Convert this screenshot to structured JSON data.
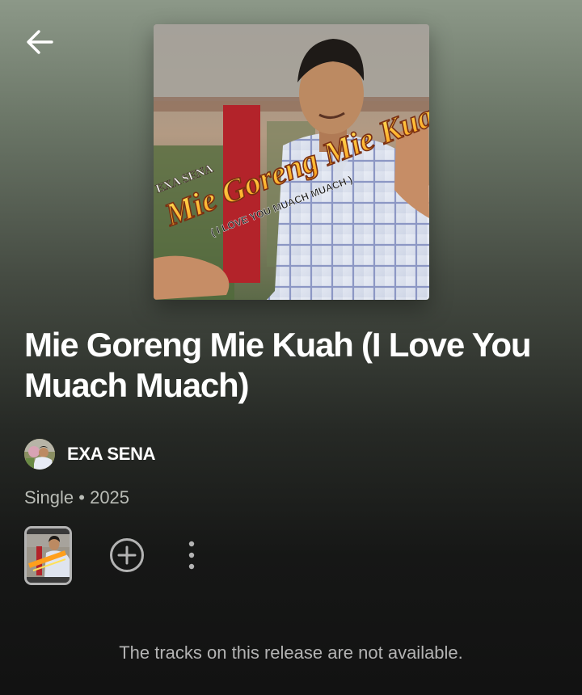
{
  "header": {
    "back_icon": "arrow-left-icon"
  },
  "album": {
    "cover_text": {
      "artist": "EXA SENA",
      "title": "Mie Goreng Mie Kuah",
      "subtitle": "( I LOVE YOU MUACH MUACH )"
    },
    "title": "Mie Goreng Mie Kuah (I Love You Muach Muach)",
    "artist_name": "EXA SENA",
    "meta": "Single • 2025"
  },
  "actions": {
    "preview_icon": "album-thumbnail",
    "add_icon": "plus-circle-icon",
    "more_icon": "more-vertical-icon"
  },
  "message": "The tracks on this release are not available.",
  "colors": {
    "text_primary": "#ffffff",
    "text_secondary": "#b3b3b3",
    "background": "#121212"
  }
}
